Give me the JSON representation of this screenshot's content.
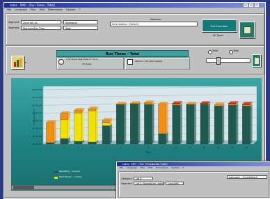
{
  "window": {
    "title": "Lotus · SMO · [Run Times · Total]",
    "menu": [
      "File",
      "Language",
      "Plan",
      "Edit",
      "Dimensions",
      "System",
      "?"
    ]
  },
  "filters": {
    "row1_label": "Segment",
    "row1_value": "Zone Set 24",
    "row1_value2": "Normalize",
    "row2_label": "Segment",
    "row2_value": "Machine/Run Time",
    "row2_value2": "Total"
  },
  "search": {
    "label": "Selection",
    "value": "time relative - [Select]"
  },
  "action_button": "Test Execution",
  "action_sub": "All Types",
  "chart_header": "Run Times - Total",
  "chart_sub": {
    "left": "CCM PLAN 19/8/1999 17:39 1/...",
    "left2": "All Types",
    "right": "SDO 8.4 +18 (Not loaded)"
  },
  "option_a": "Total",
  "option_b": "Total",
  "legend": [
    "Operating · running",
    "Fault Repair · running",
    "Oper. Repairs",
    "Fault Repair"
  ],
  "chart_data": {
    "type": "bar",
    "stacked": true,
    "ylabel": "Amount of time",
    "xlabel": "Time",
    "yticks": [
      "10:47:30",
      "10:44:55",
      "10:42:20",
      "10:39:45",
      "10:37:10",
      "10:34:35",
      "10:32:00",
      "10:29:25"
    ],
    "ylim": [
      0,
      8
    ],
    "categories": [
      "1",
      "2",
      "3",
      "4",
      "5",
      "6",
      "7",
      "8",
      "9",
      "10",
      "11",
      "12",
      "13",
      "14",
      "15"
    ],
    "series": [
      {
        "name": "Operating · running",
        "color": "#1f5a50",
        "values": [
          0.2,
          0.8,
          0.4,
          0.3,
          2.7,
          5.8,
          5.9,
          5.8,
          1.5,
          5.7,
          5.8,
          5.8,
          5.6,
          5.7,
          5.6
        ]
      },
      {
        "name": "Fault Repair · running",
        "color": "#f2e200",
        "values": [
          0,
          2.8,
          4.2,
          4.6,
          0.4,
          0,
          0,
          0.1,
          0,
          0,
          0,
          0,
          0,
          0,
          0
        ]
      },
      {
        "name": "Oper. Repairs",
        "color": "#f39012",
        "values": [
          3.0,
          0.9,
          0.4,
          0.3,
          0.4,
          0.1,
          0.1,
          0.2,
          4.4,
          0.2,
          0.1,
          0.1,
          0.2,
          0.2,
          0.2
        ]
      },
      {
        "name": "Fault Repair",
        "color": "#d32a1a",
        "values": [
          0,
          0,
          0,
          0,
          0,
          0,
          0,
          0,
          0,
          0.1,
          0,
          0.1,
          0,
          0.1,
          0.1
        ]
      }
    ]
  },
  "window2": {
    "title": "Lotus · SMO · [Run Time/Access Code]",
    "menu": [
      "File",
      "Language",
      "Plan",
      "Edit",
      "Dimensions",
      "System",
      "?"
    ],
    "f1_label": "Category",
    "f1_value": "Lot A",
    "f2_label": "Segment",
    "f2_value": "Lot A (Normalize) [dwg]",
    "f2_value2": "Calculate",
    "right_value": "pathogen - Outlet/Batch"
  }
}
